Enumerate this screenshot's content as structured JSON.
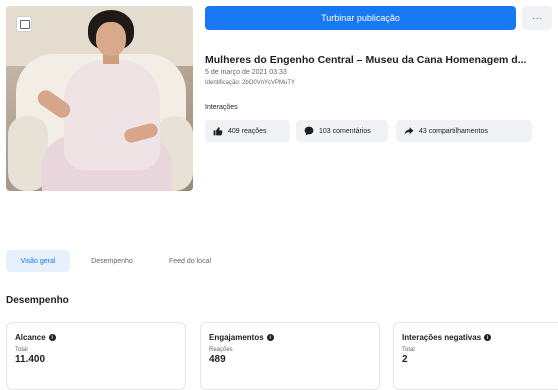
{
  "actions": {
    "boost_label": "Turbinar publicação",
    "more_label": "···"
  },
  "post": {
    "title": "Mulheres do Engenho Central – Museu da Cana Homenagem d...",
    "date": "5 de março de 2021 03:33",
    "id": "Identificação: 2bO0VnYcVPMuTY"
  },
  "interactions": {
    "label": "Interações",
    "reactions": "409 reações",
    "comments": "103 comentários",
    "shares": "43 compartilhamentos"
  },
  "tabs": [
    {
      "label": "Visão geral"
    },
    {
      "label": "Desempenho"
    },
    {
      "label": "Feed do local"
    }
  ],
  "section": {
    "title": "Desempenho"
  },
  "metrics": [
    {
      "title": "Alcance",
      "sub": "Total",
      "value": "11.400"
    },
    {
      "title": "Engajamentos",
      "sub": "Reações",
      "value": "489"
    },
    {
      "title": "Interações negativas",
      "sub": "Total",
      "value": "2"
    }
  ],
  "colors": {
    "accent": "#1877f2",
    "pill_bg": "#f0f2f5",
    "text": "#1c1e21"
  },
  "icons": {
    "reactions": "thumbs-up-icon",
    "comments": "comment-icon",
    "shares": "share-icon",
    "info": "info-icon",
    "photo": "photo-icon"
  }
}
